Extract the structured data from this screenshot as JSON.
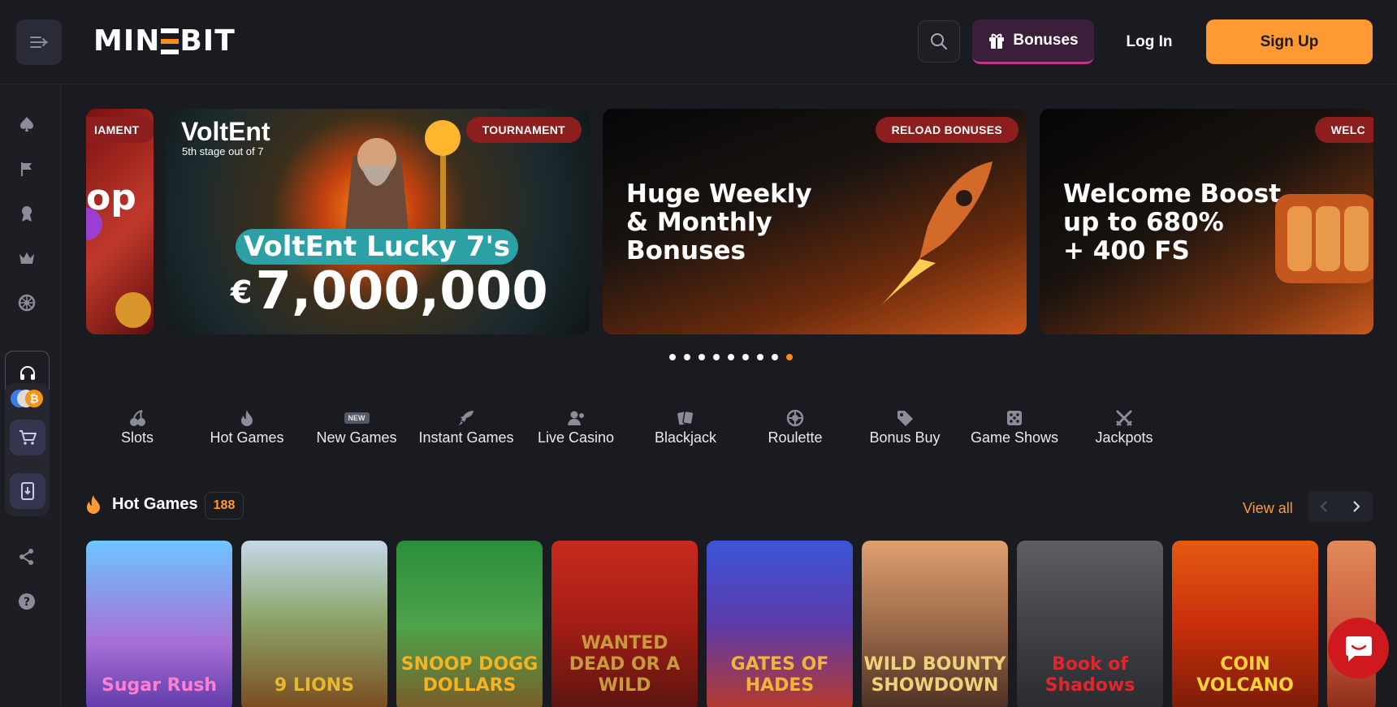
{
  "header": {
    "logo_left": "MIN",
    "logo_right": "BIT",
    "bonuses_label": "Bonuses",
    "login_label": "Log In",
    "signup_label": "Sign Up"
  },
  "banners": [
    {
      "tag": "TOURNAMENT",
      "partial_tag": "IAMENT",
      "partial_text": "op"
    },
    {
      "tag": "TOURNAMENT",
      "brand": "VoltEnt",
      "stage": "5th stage out of 7",
      "title": "VoltEnt Lucky 7's",
      "currency": "€",
      "prize": "7,000,000"
    },
    {
      "tag": "RELOAD BONUSES",
      "title": "Huge Weekly\n& Monthly\nBonuses"
    },
    {
      "tag": "WELC",
      "title": "Welcome Boost\nup to 680%\n+ 400 FS"
    }
  ],
  "carousel": {
    "dot_count": 9,
    "active_index": 8
  },
  "categories": [
    {
      "label": "Slots",
      "icon": "cherries-icon"
    },
    {
      "label": "Hot Games",
      "icon": "flame-icon"
    },
    {
      "label": "New Games",
      "icon": "new-badge-icon",
      "badge": "NEW"
    },
    {
      "label": "Instant Games",
      "icon": "rocket-icon"
    },
    {
      "label": "Live Casino",
      "icon": "dealer-icon"
    },
    {
      "label": "Blackjack",
      "icon": "cards-icon"
    },
    {
      "label": "Roulette",
      "icon": "roulette-icon"
    },
    {
      "label": "Bonus Buy",
      "icon": "tag-icon"
    },
    {
      "label": "Game Shows",
      "icon": "dice-icon"
    },
    {
      "label": "Jackpots",
      "icon": "crossed-swords-icon"
    }
  ],
  "hot_games": {
    "title": "Hot Games",
    "count": "188",
    "view_all": "View all",
    "games": [
      {
        "name": "Sugar Rush",
        "bg": "#8a5fc7",
        "color": "#ff7ed2"
      },
      {
        "name": "9 LIONS",
        "bg": "#8a6c3a",
        "color": "#e6b830"
      },
      {
        "name": "SNOOP DOGG DOLLARS",
        "bg": "#3e8a3c",
        "color": "#f4b323"
      },
      {
        "name": "WANTED DEAD OR A WILD",
        "bg": "#b5231c",
        "color": "#c79a3c"
      },
      {
        "name": "GATES OF HADES",
        "bg": "#3a3d9a",
        "color": "#f0b43a"
      },
      {
        "name": "WILD BOUNTY SHOWDOWN",
        "bg": "#b46b3a",
        "color": "#f2d07a"
      },
      {
        "name": "Book of Shadows",
        "bg": "#4a4c52",
        "color": "#e0262b"
      },
      {
        "name": "COIN VOLCANO",
        "bg": "#cc3a10",
        "color": "#ffd23a"
      },
      {
        "name": "",
        "bg": "#c95a3a",
        "color": "#fff"
      }
    ]
  }
}
